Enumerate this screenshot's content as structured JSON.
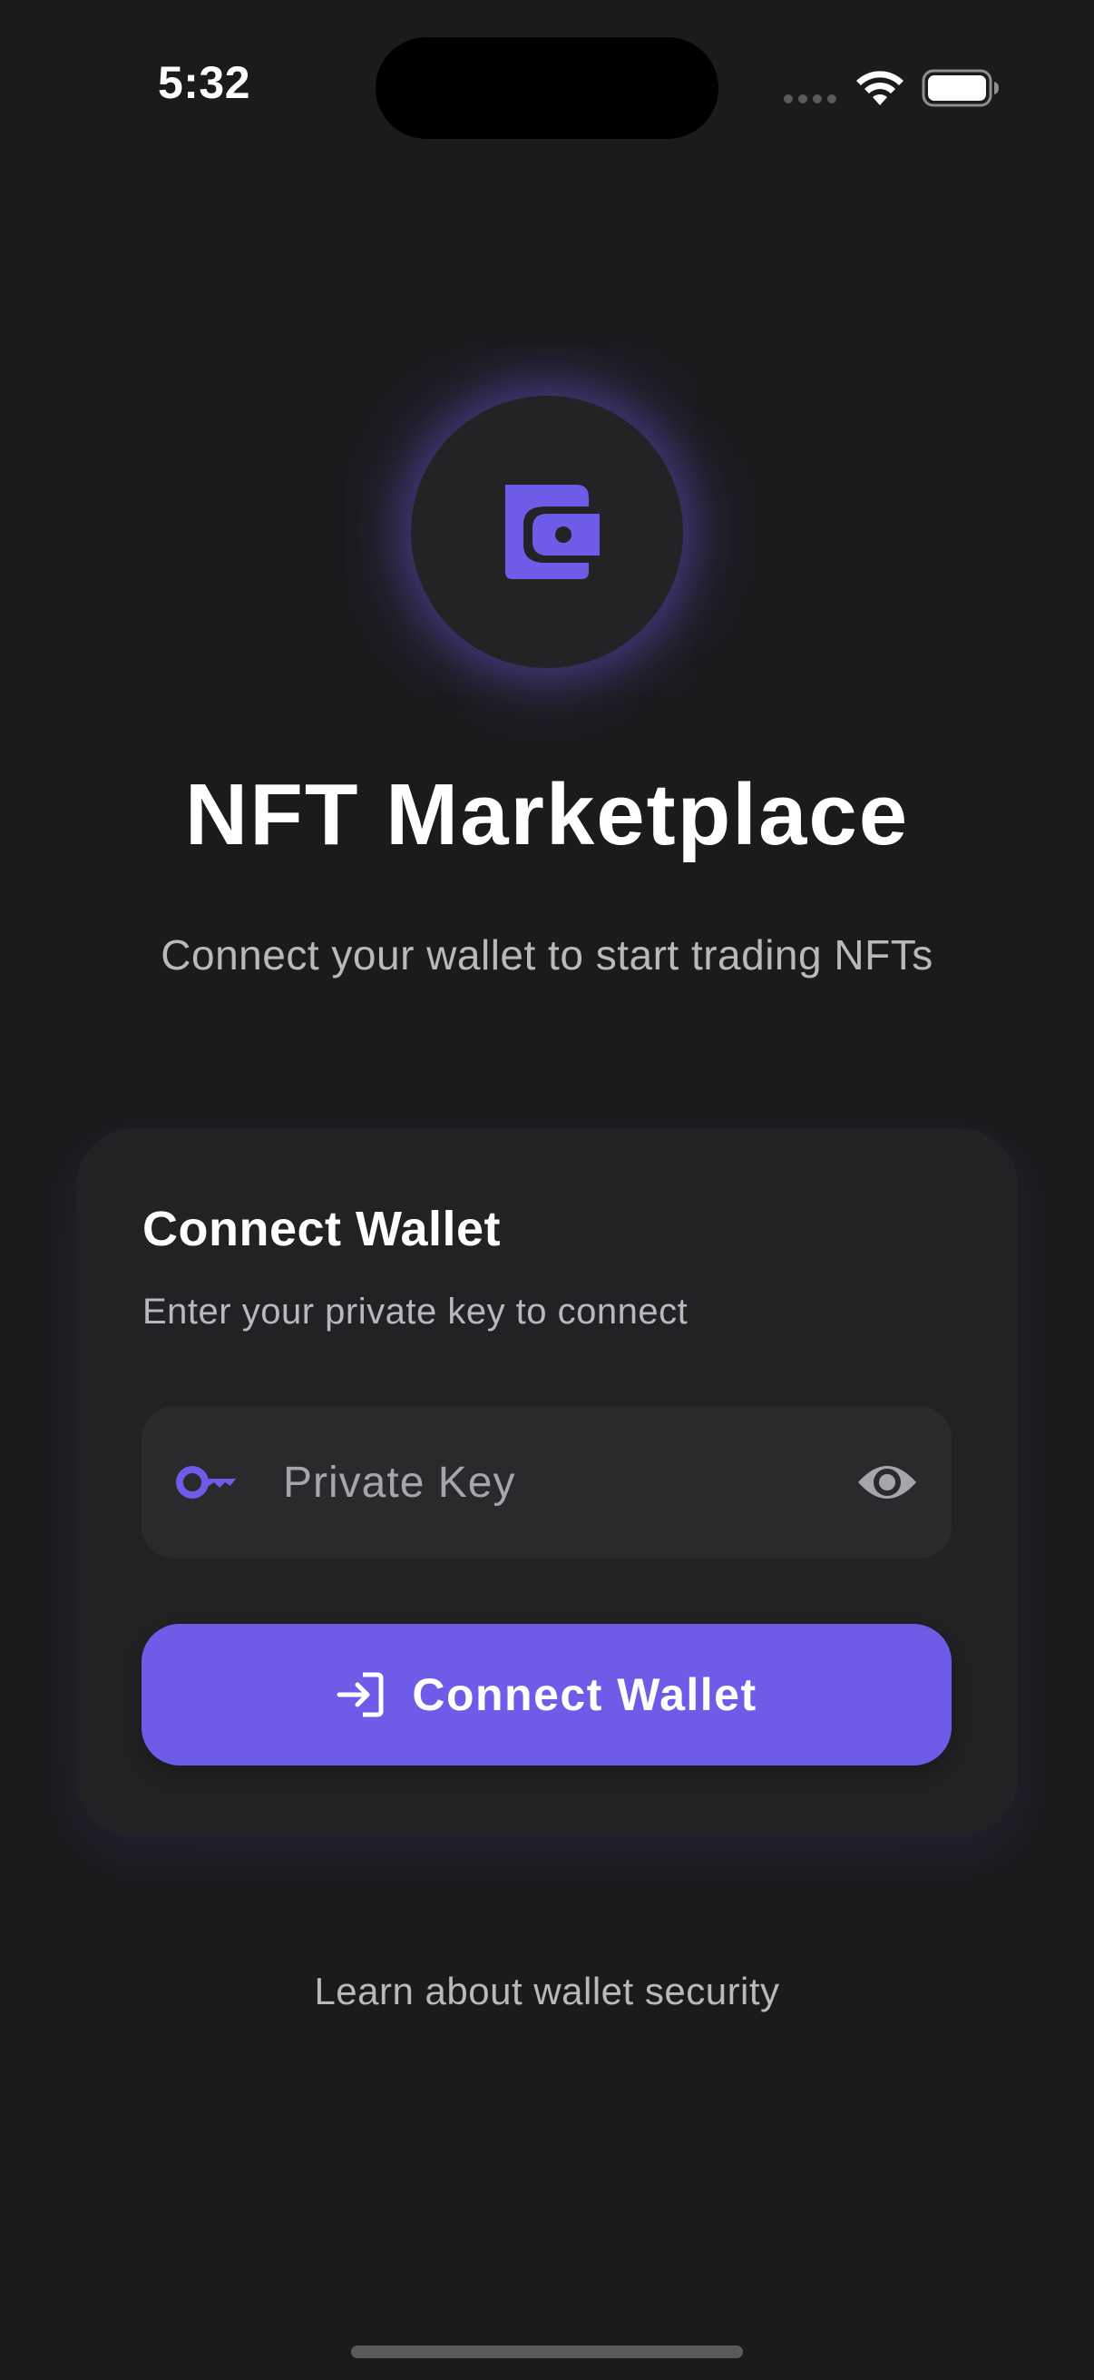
{
  "status_bar": {
    "time": "5:32",
    "icons": [
      "signal-dots-icon",
      "wifi-icon",
      "battery-icon"
    ]
  },
  "header": {
    "logo_icon": "wallet-icon",
    "title": "NFT Marketplace",
    "subtitle": "Connect your wallet to start trading NFTs"
  },
  "card": {
    "title": "Connect Wallet",
    "subtitle": "Enter your private key to connect",
    "private_key": {
      "placeholder": "Private Key",
      "value": "",
      "leading_icon": "key-icon",
      "trailing_icon": "eye-icon"
    },
    "connect_button": {
      "label": "Connect Wallet",
      "icon": "login-icon"
    }
  },
  "footer": {
    "security_link": "Learn about wallet security"
  },
  "colors": {
    "background": "#1b1b1c",
    "card": "#222224",
    "field": "#2a2a2c",
    "accent": "#6c5ce7",
    "muted_text": "#b9b9bd"
  }
}
